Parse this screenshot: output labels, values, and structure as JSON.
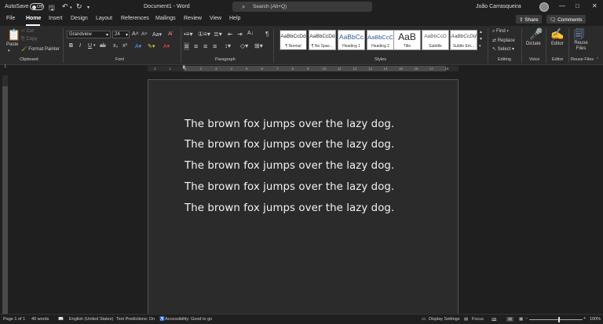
{
  "titlebar": {
    "autosave_label": "AutoSave",
    "autosave_state": "Off",
    "doc_title": "Document1 - Word",
    "search_placeholder": "Search (Alt+Q)",
    "user_name": "João Carrasqueira"
  },
  "tabs": [
    "File",
    "Home",
    "Insert",
    "Design",
    "Layout",
    "References",
    "Mailings",
    "Review",
    "View",
    "Help"
  ],
  "active_tab": "Home",
  "top_buttons": {
    "share": "Share",
    "comments": "Comments"
  },
  "ribbon": {
    "clipboard": {
      "label": "Clipboard",
      "paste": "Paste",
      "cut": "Cut",
      "copy": "Copy",
      "format_painter": "Format Painter"
    },
    "font": {
      "label": "Font",
      "font_name": "Grandview",
      "font_size": "24"
    },
    "paragraph": {
      "label": "Paragraph"
    },
    "styles": {
      "label": "Styles",
      "items": [
        {
          "preview": "AaBbCcDd",
          "name": "¶ Normal",
          "color": "#222222"
        },
        {
          "preview": "AaBbCcDd",
          "name": "¶ No Spac...",
          "color": "#222222"
        },
        {
          "preview": "AaBbCc",
          "name": "Heading 1",
          "color": "#2f5597"
        },
        {
          "preview": "AaBbCcC",
          "name": "Heading 2",
          "color": "#2f5597"
        },
        {
          "preview": "AaB",
          "name": "Title",
          "color": "#222222"
        },
        {
          "preview": "AaBbCcD",
          "name": "Subtitle",
          "color": "#595959"
        },
        {
          "preview": "AaBbCcDd",
          "name": "Subtle Em...",
          "color": "#404040"
        }
      ]
    },
    "editing": {
      "label": "Editing",
      "find": "Find",
      "replace": "Replace",
      "select": "Select"
    },
    "voice": {
      "label": "Voice",
      "dictate": "Dictate"
    },
    "editor": {
      "label": "Editor",
      "editor": "Editor"
    },
    "reuse": {
      "label": "Reuse Files",
      "reuse": "Reuse Files"
    }
  },
  "ruler": {
    "marks": [
      "2",
      "1",
      "1",
      "2",
      "3",
      "4",
      "5",
      "6",
      "7",
      "8",
      "9",
      "10",
      "11",
      "12",
      "13",
      "14",
      "15",
      "16",
      "17",
      "18"
    ]
  },
  "document": {
    "lines": [
      "The brown fox jumps over the lazy dog.",
      "The brown fox jumps over the lazy dog.",
      "The brown fox jumps over the lazy dog.",
      "The brown fox jumps over the lazy dog.",
      "The brown fox jumps over the lazy dog."
    ]
  },
  "status": {
    "page": "Page 1 of 1",
    "words": "40 words",
    "language": "English (United States)",
    "text_predictions": "Text Predictions: On",
    "accessibility": "Accessibility: Good to go",
    "display_settings": "Display Settings",
    "focus": "Focus",
    "zoom": "100%"
  }
}
